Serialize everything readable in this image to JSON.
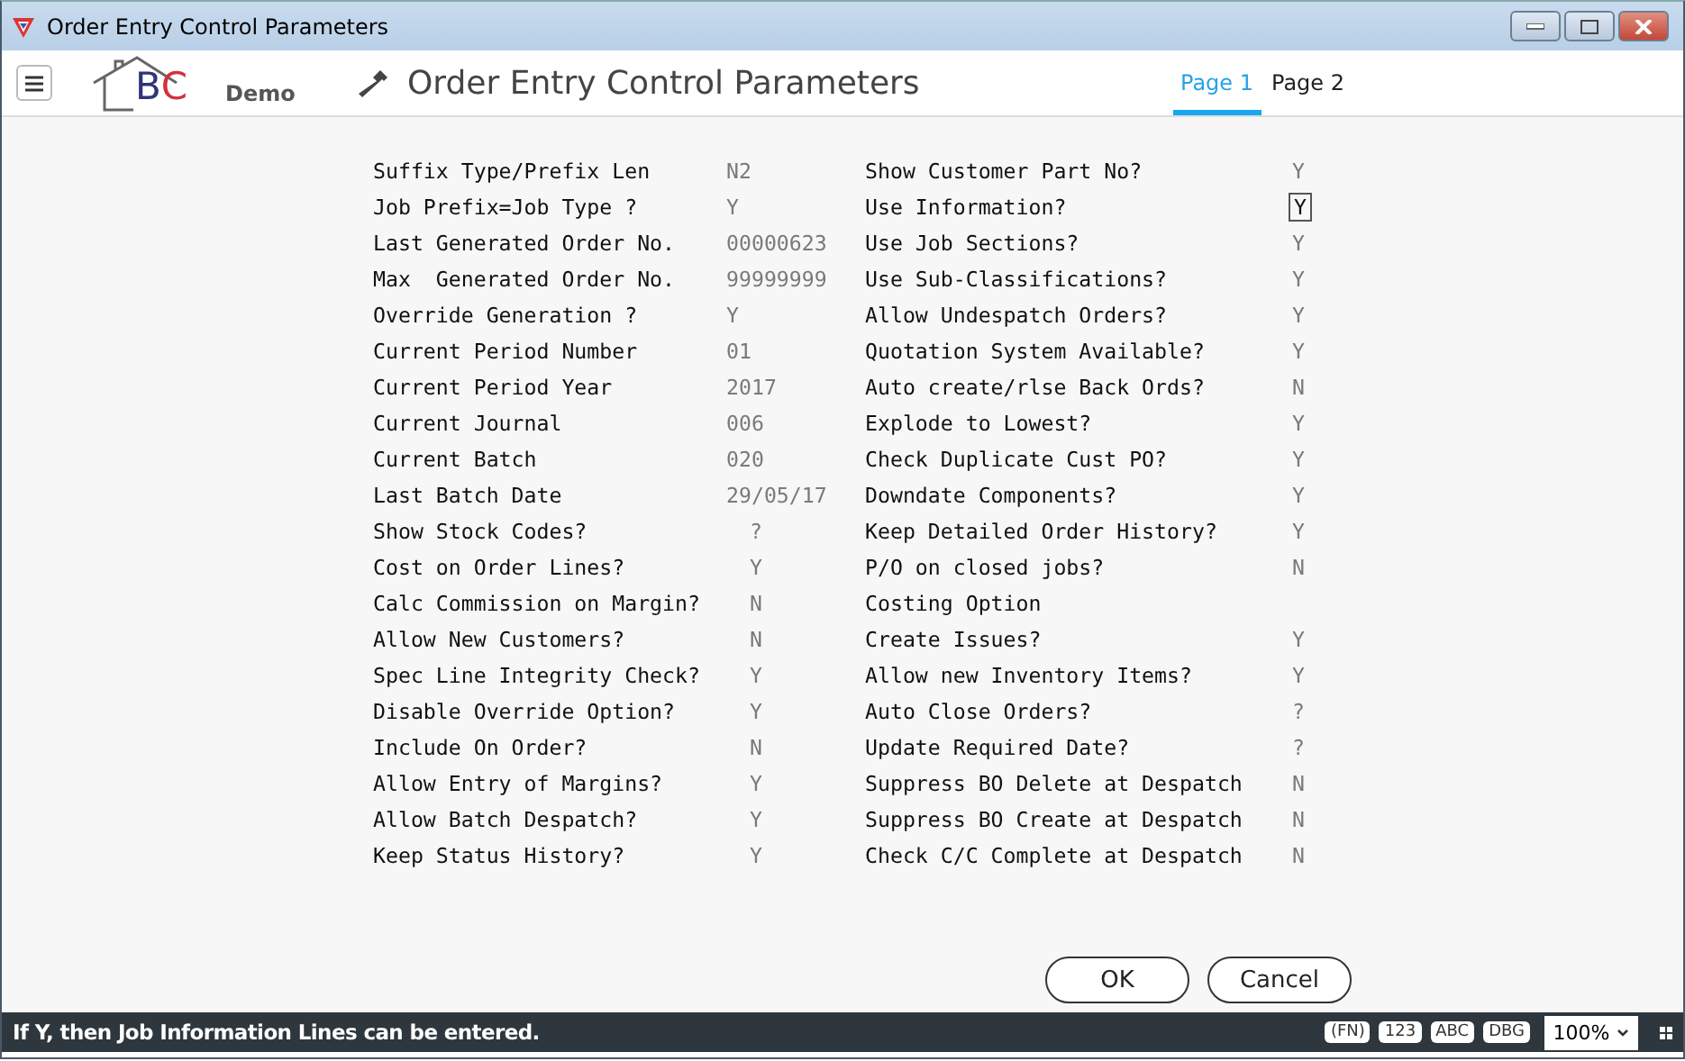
{
  "window": {
    "title": "Order Entry Control Parameters"
  },
  "header": {
    "logo_letters": [
      {
        "text": "B",
        "color": "#2f3576"
      },
      {
        "text": "C",
        "color": "#d3313a"
      }
    ],
    "logo_caption": "Demo",
    "title": "Order Entry Control Parameters"
  },
  "tabs": [
    {
      "label": "Page 1",
      "selected": true
    },
    {
      "label": "Page 2",
      "selected": false
    }
  ],
  "columns": [
    {
      "fields": [
        {
          "label": "Suffix Type/Prefix Len",
          "value": "N2",
          "kind": "text",
          "focused": false
        },
        {
          "label": "Job Prefix=Job Type ?",
          "value": "Y",
          "kind": "text",
          "focused": false
        },
        {
          "label": "Last Generated Order No.",
          "value": "00000623",
          "kind": "text",
          "focused": false
        },
        {
          "label": "Max  Generated Order No.",
          "value": "99999999",
          "kind": "text",
          "focused": false
        },
        {
          "label": "Override Generation ?",
          "value": "Y",
          "kind": "text",
          "focused": false
        },
        {
          "label": "Current Period Number",
          "value": "01",
          "kind": "text",
          "focused": false
        },
        {
          "label": "Current Period Year",
          "value": "2017",
          "kind": "text",
          "focused": false
        },
        {
          "label": "Current Journal",
          "value": "006",
          "kind": "text",
          "focused": false
        },
        {
          "label": "Current Batch",
          "value": "020",
          "kind": "text",
          "focused": false
        },
        {
          "label": "Last Batch Date",
          "value": "29/05/17",
          "kind": "text",
          "focused": false
        },
        {
          "label": "Show Stock Codes?",
          "value": "?",
          "kind": "flag",
          "focused": false
        },
        {
          "label": "Cost on Order Lines?",
          "value": "Y",
          "kind": "flag",
          "focused": false
        },
        {
          "label": "Calc Commission on Margin?",
          "value": "N",
          "kind": "flag",
          "focused": false
        },
        {
          "label": "Allow New Customers?",
          "value": "N",
          "kind": "flag",
          "focused": false
        },
        {
          "label": "Spec Line Integrity Check?",
          "value": "Y",
          "kind": "flag",
          "focused": false
        },
        {
          "label": "Disable Override Option?",
          "value": "Y",
          "kind": "flag",
          "focused": false
        },
        {
          "label": "Include On Order?",
          "value": "N",
          "kind": "flag",
          "focused": false
        },
        {
          "label": "Allow Entry of Margins?",
          "value": "Y",
          "kind": "flag",
          "focused": false
        },
        {
          "label": "Allow Batch Despatch?",
          "value": "Y",
          "kind": "flag",
          "focused": false
        },
        {
          "label": "Keep Status History?",
          "value": "Y",
          "kind": "flag",
          "focused": false
        }
      ]
    },
    {
      "fields": [
        {
          "label": "Show Customer Part No?",
          "value": "Y",
          "focused": false
        },
        {
          "label": "Use Information?",
          "value": "Y",
          "focused": true
        },
        {
          "label": "Use Job Sections?",
          "value": "Y",
          "focused": false
        },
        {
          "label": "Use Sub-Classifications?",
          "value": "Y",
          "focused": false
        },
        {
          "label": "Allow Undespatch Orders?",
          "value": "Y",
          "focused": false
        },
        {
          "label": "Quotation System Available?",
          "value": "Y",
          "focused": false
        },
        {
          "label": "Auto create/rlse Back Ords?",
          "value": "N",
          "focused": false
        },
        {
          "label": "Explode to Lowest?",
          "value": "Y",
          "focused": false
        },
        {
          "label": "Check Duplicate Cust PO?",
          "value": "Y",
          "focused": false
        },
        {
          "label": "Downdate Components?",
          "value": "Y",
          "focused": false
        },
        {
          "label": "Keep Detailed Order History?",
          "value": "Y",
          "focused": false
        },
        {
          "label": "P/O on closed jobs?",
          "value": "N",
          "focused": false
        },
        {
          "label": "Costing Option",
          "focused": false
        },
        {
          "label": "Create Issues?",
          "value": "Y",
          "focused": false
        },
        {
          "label": "Allow new Inventory Items?",
          "value": "Y",
          "focused": false
        },
        {
          "label": "Auto Close Orders?",
          "value": "?",
          "focused": false
        },
        {
          "label": "Update Required Date?",
          "value": "?",
          "focused": false
        },
        {
          "label": "Suppress BO Delete at Despatch",
          "value": "N",
          "focused": false
        },
        {
          "label": "Suppress BO Create at Despatch",
          "value": "N",
          "focused": false
        },
        {
          "label": "Check C/C Complete at Despatch",
          "value": "N",
          "focused": false
        }
      ]
    }
  ],
  "buttons": [
    "OK",
    "Cancel"
  ],
  "status_bar": {
    "message": "If Y, then Job Information Lines can be entered.",
    "keys": [
      "(FN)",
      "123",
      "ABC",
      "DBG"
    ],
    "zoom": "100%"
  }
}
